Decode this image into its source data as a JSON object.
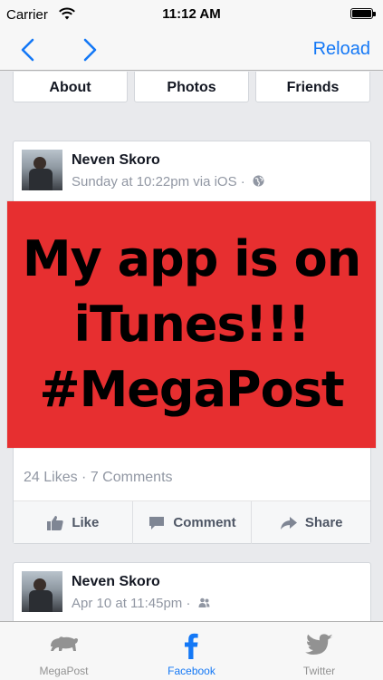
{
  "status_bar": {
    "carrier": "Carrier",
    "time": "11:12 AM",
    "battery_level": 1.0
  },
  "nav": {
    "back_icon": "chevron-left-icon",
    "forward_icon": "chevron-right-icon",
    "reload_label": "Reload",
    "accent_color": "#1478f6"
  },
  "profile_tabs": [
    {
      "label": "About"
    },
    {
      "label": "Photos"
    },
    {
      "label": "Friends"
    }
  ],
  "posts": [
    {
      "author": "Neven Skoro",
      "meta": "Sunday at 10:22pm via iOS ·",
      "privacy_icon": "globe-icon",
      "image_text": [
        "My app is on",
        "iTunes!!!",
        "#MegaPost"
      ],
      "image_color": "#e72f30",
      "stats": "24 Likes · 7 Comments",
      "actions": [
        "Like",
        "Comment",
        "Share"
      ]
    },
    {
      "author": "Neven Skoro",
      "meta": "Apr 10 at 11:45pm ·",
      "privacy_icon": "friends-icon"
    }
  ],
  "tab_bar": {
    "items": [
      {
        "label": "MegaPost",
        "icon": "bear-icon",
        "active": false
      },
      {
        "label": "Facebook",
        "icon": "facebook-icon",
        "active": true
      },
      {
        "label": "Twitter",
        "icon": "twitter-bird-icon",
        "active": false
      }
    ],
    "active_color": "#1478f6",
    "inactive_color": "#929292"
  }
}
